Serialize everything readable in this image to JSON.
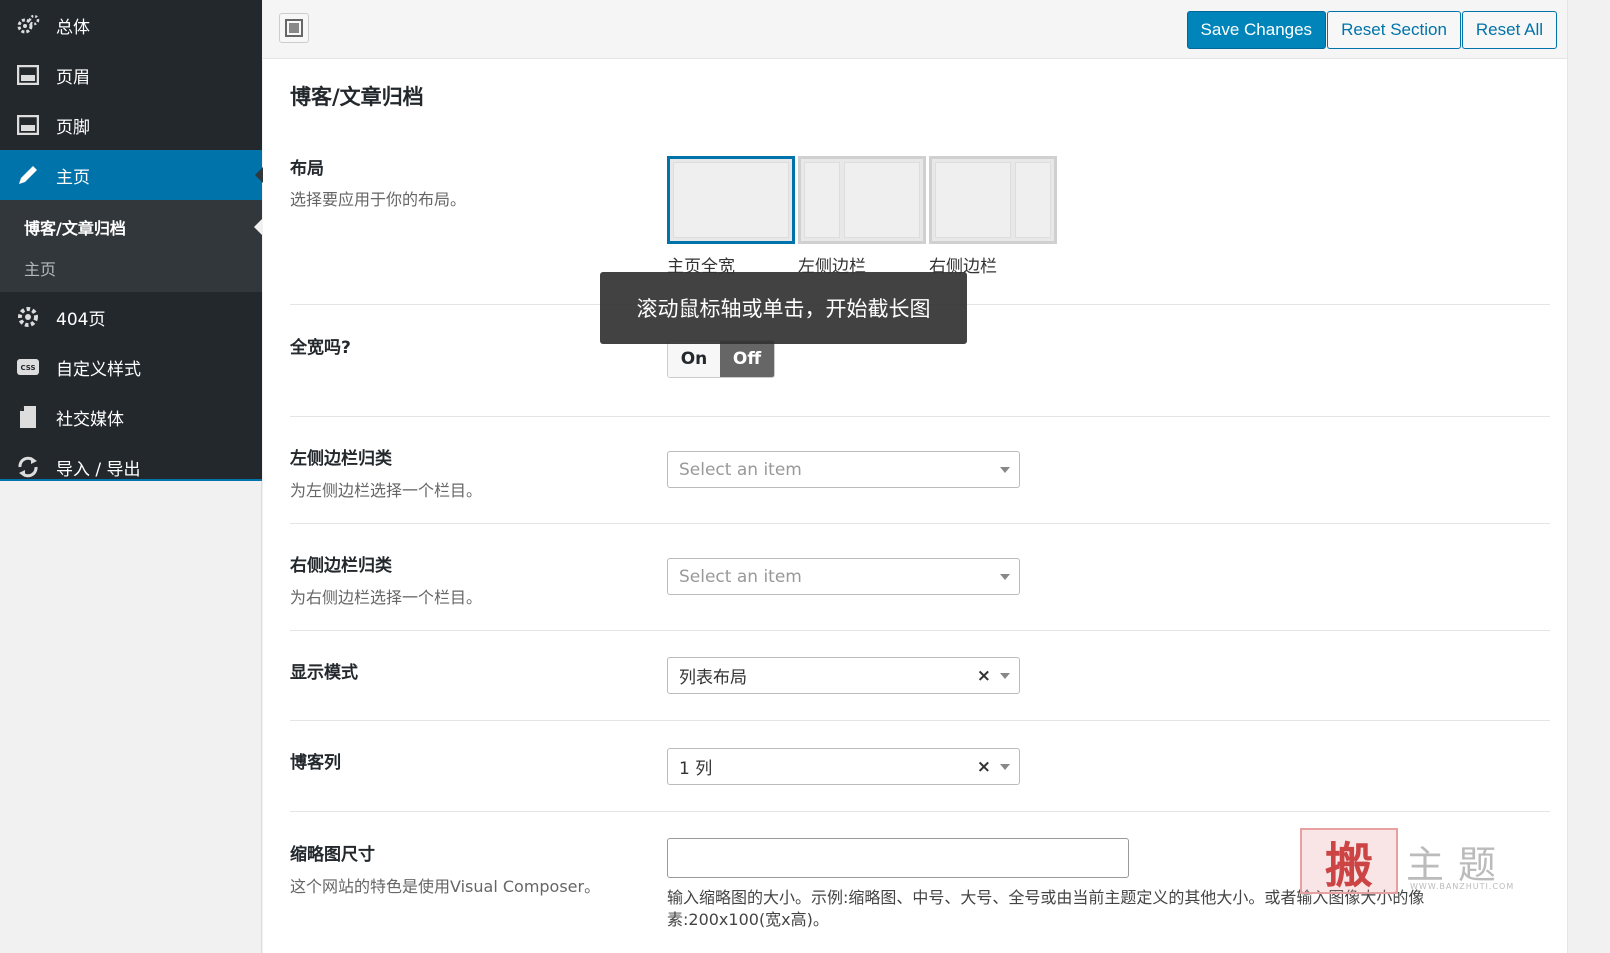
{
  "sidebar": {
    "items": [
      {
        "label": "总体",
        "icon": "gears-icon"
      },
      {
        "label": "页眉",
        "icon": "header-layout-icon"
      },
      {
        "label": "页脚",
        "icon": "footer-layout-icon"
      },
      {
        "label": "主页",
        "icon": "pencil-icon"
      },
      {
        "label": "404页",
        "icon": "gear-icon"
      },
      {
        "label": "自定义样式",
        "icon": "css-icon"
      },
      {
        "label": "社交媒体",
        "icon": "document-icon"
      },
      {
        "label": "导入 / 导出",
        "icon": "refresh-icon"
      }
    ],
    "submenu": [
      {
        "label": "博客/文章归档"
      },
      {
        "label": "主页"
      }
    ]
  },
  "toolbar": {
    "save_label": "Save Changes",
    "reset_section_label": "Reset Section",
    "reset_all_label": "Reset All"
  },
  "section": {
    "title": "博客/文章归档"
  },
  "fields": {
    "layout": {
      "label": "布局",
      "desc": "选择要应用于你的布局。",
      "options": [
        "主页全宽",
        "左侧边栏",
        "右侧边栏"
      ]
    },
    "fullwidth": {
      "label": "全宽吗?",
      "on": "On",
      "off": "Off"
    },
    "left_cat": {
      "label": "左侧边栏归类",
      "desc": "为左侧边栏选择一个栏目。",
      "placeholder": "Select an item"
    },
    "right_cat": {
      "label": "右侧边栏归类",
      "desc": "为右侧边栏选择一个栏目。",
      "placeholder": "Select an item"
    },
    "display_mode": {
      "label": "显示模式",
      "value": "列表布局"
    },
    "blog_columns": {
      "label": "博客列",
      "value": "1 列"
    },
    "thumb_size": {
      "label": "缩略图尺寸",
      "desc": "这个网站的特色是使用Visual Composer。",
      "value": "",
      "help": "输入缩略图的大小。示例:缩略图、中号、大号、全号或由当前主题定义的其他大小。或者输入图像大小的像素:200x100(宽x高)。"
    }
  },
  "tooltip": {
    "text": "滚动鼠标轴或单击，开始截长图"
  },
  "watermark": {
    "seal": "搬",
    "text": "主题",
    "url": "WWW.BANZHUTI.COM"
  },
  "colors": {
    "sidebar_bg": "#23282d",
    "accent": "#0073aa",
    "primary_btn": "#0085ba"
  }
}
